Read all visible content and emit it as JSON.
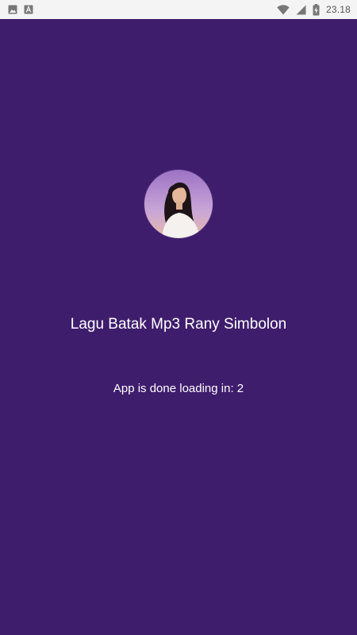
{
  "status_bar": {
    "left_icons": [
      "image-icon",
      "font-a-icon"
    ],
    "right_icons": [
      "wifi-icon",
      "cell-signal-icon",
      "battery-charging-icon"
    ],
    "time": "23.18"
  },
  "splash": {
    "avatar_icon": "singer-portrait-image",
    "title": "Lagu Batak Mp3 Rany Simbolon",
    "loading_label": "App is done loading in: 2"
  },
  "colors": {
    "background": "#3f1d6d",
    "status_bar": "#f4f4f4",
    "text": "#ffffff"
  }
}
